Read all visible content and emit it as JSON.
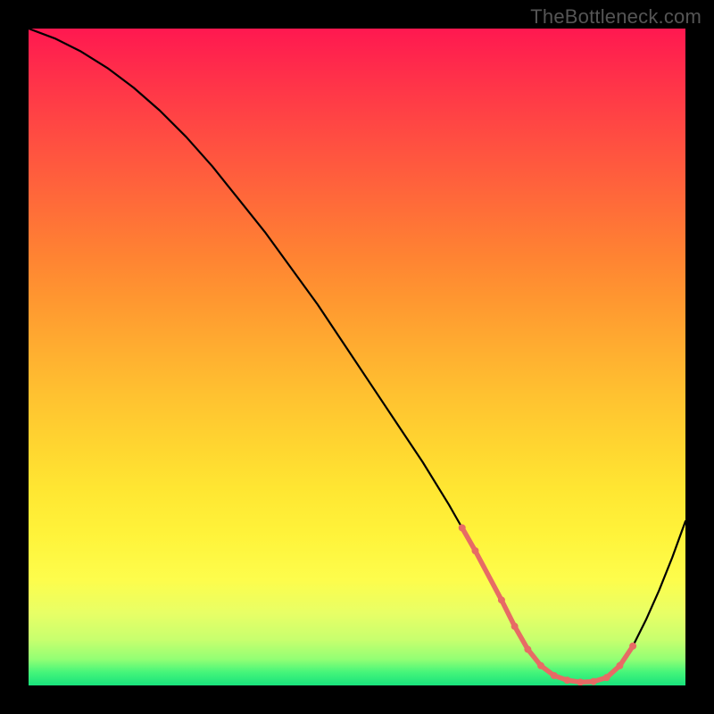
{
  "watermark": "TheBottleneck.com",
  "chart_data": {
    "type": "line",
    "title": "",
    "xlabel": "",
    "ylabel": "",
    "xlim": [
      0,
      100
    ],
    "ylim": [
      0,
      100
    ],
    "grid": false,
    "legend": false,
    "series": [
      {
        "name": "curve",
        "x": [
          0,
          4,
          8,
          12,
          16,
          20,
          24,
          28,
          32,
          36,
          40,
          44,
          48,
          52,
          56,
          60,
          64,
          66,
          68,
          70,
          72,
          74,
          76,
          78,
          80,
          82,
          84,
          86,
          88,
          90,
          92,
          94,
          96,
          98,
          100
        ],
        "y": [
          100,
          98.5,
          96.5,
          94,
          91,
          87.5,
          83.5,
          79,
          74,
          69,
          63.5,
          58,
          52,
          46,
          40,
          34,
          27.5,
          24,
          20.5,
          17,
          13,
          9,
          5.5,
          3,
          1.5,
          0.8,
          0.5,
          0.6,
          1.2,
          3,
          6,
          10,
          14.5,
          19.5,
          25
        ]
      }
    ],
    "markers": {
      "name": "highlight",
      "color": "#e76b65",
      "x": [
        66,
        68,
        72,
        74,
        76,
        78,
        80,
        82,
        84,
        86,
        88,
        90,
        92
      ],
      "y": [
        24,
        20.5,
        13,
        9,
        5.5,
        3,
        1.5,
        0.8,
        0.5,
        0.6,
        1.2,
        3,
        6
      ]
    }
  }
}
